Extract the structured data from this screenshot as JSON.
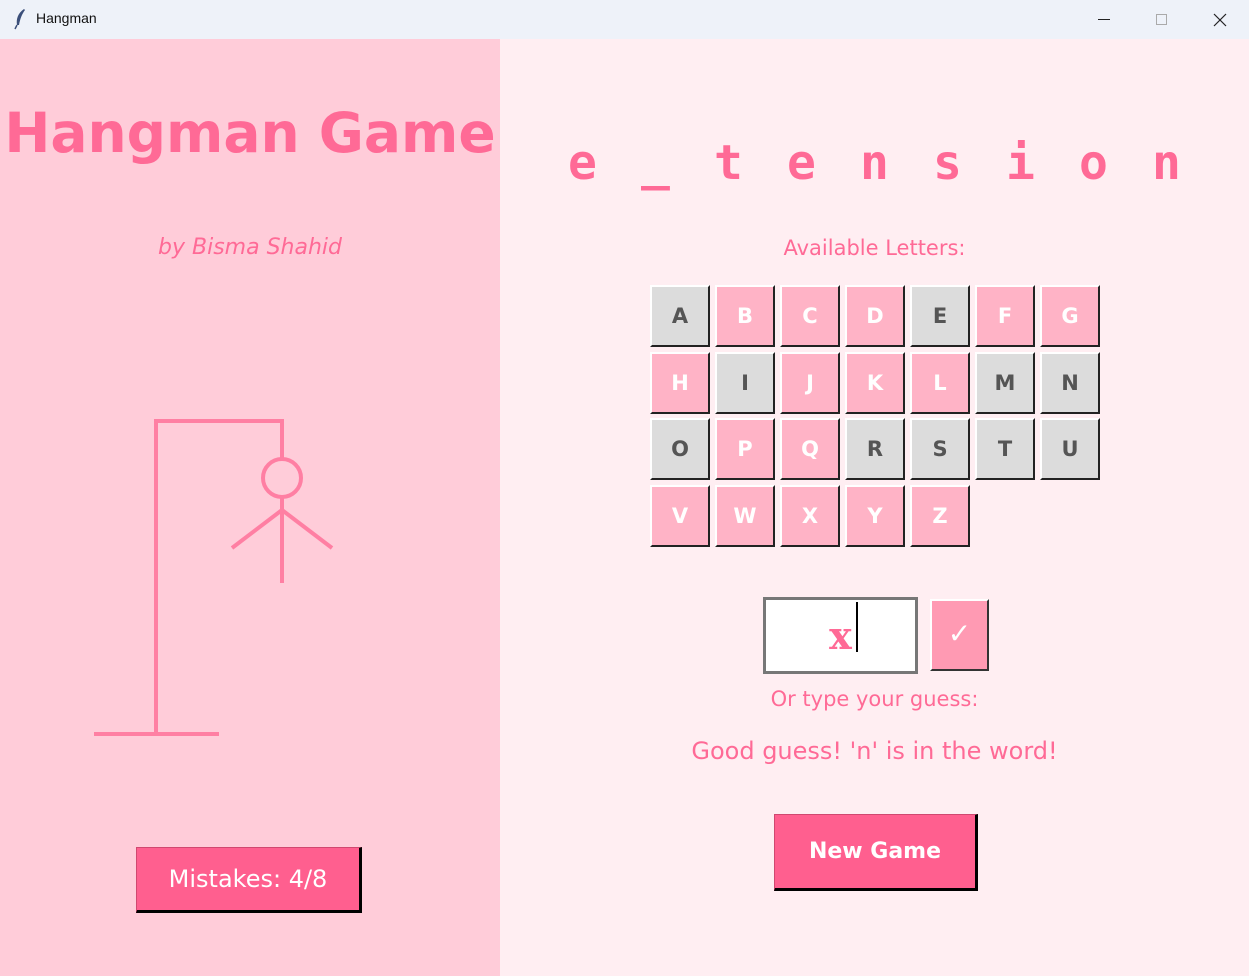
{
  "window": {
    "title": "Hangman",
    "minimize": "—",
    "maximize": "□",
    "close": "✕"
  },
  "left_panel": {
    "title": "Hangman Game",
    "byline": "by Bisma Shahid",
    "mistakes": "Mistakes: 4/8",
    "drawing_color": "#ff7fa3"
  },
  "right_panel": {
    "word_letters": [
      "e",
      "_",
      "t",
      "e",
      "n",
      "s",
      "i",
      "o",
      "n"
    ],
    "available_label": "Available Letters:",
    "letters": [
      {
        "letter": "A",
        "used": true
      },
      {
        "letter": "B",
        "used": false
      },
      {
        "letter": "C",
        "used": false
      },
      {
        "letter": "D",
        "used": false
      },
      {
        "letter": "E",
        "used": true
      },
      {
        "letter": "F",
        "used": false
      },
      {
        "letter": "G",
        "used": false
      },
      {
        "letter": "H",
        "used": false
      },
      {
        "letter": "I",
        "used": true
      },
      {
        "letter": "J",
        "used": false
      },
      {
        "letter": "K",
        "used": false
      },
      {
        "letter": "L",
        "used": false
      },
      {
        "letter": "M",
        "used": true
      },
      {
        "letter": "N",
        "used": true
      },
      {
        "letter": "O",
        "used": true
      },
      {
        "letter": "P",
        "used": false
      },
      {
        "letter": "Q",
        "used": false
      },
      {
        "letter": "R",
        "used": true
      },
      {
        "letter": "S",
        "used": true
      },
      {
        "letter": "T",
        "used": true
      },
      {
        "letter": "U",
        "used": true
      },
      {
        "letter": "V",
        "used": false
      },
      {
        "letter": "W",
        "used": false
      },
      {
        "letter": "X",
        "used": false
      },
      {
        "letter": "Y",
        "used": false
      },
      {
        "letter": "Z",
        "used": false
      }
    ],
    "guess_value": "x",
    "submit_label": "✓",
    "or_type_label": "Or type your guess:",
    "status_message": "Good guess! 'n' is in the word!",
    "new_game_label": "New Game"
  },
  "colors": {
    "accent": "#ff5f8f",
    "text_pink": "#ff6a96",
    "left_bg": "#ffccd9",
    "right_bg": "#ffeef2",
    "key_available": "#ffb3c6",
    "key_used": "#dcdcdc"
  }
}
